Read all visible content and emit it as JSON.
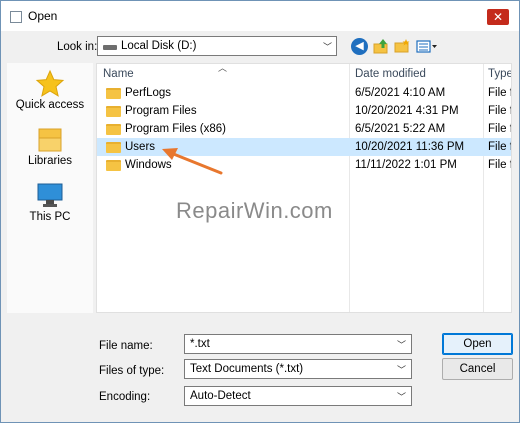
{
  "window": {
    "title": "Open",
    "close_glyph": "✕"
  },
  "toolbar": {
    "look_in_label": "Look in:",
    "look_in_value": "Local Disk (D:)",
    "buttons": [
      "back-icon",
      "up-folder-icon",
      "new-folder-icon",
      "view-menu-icon"
    ]
  },
  "places": [
    {
      "label": "Quick access",
      "icon": "star-icon"
    },
    {
      "label": "Libraries",
      "icon": "libraries-icon"
    },
    {
      "label": "This PC",
      "icon": "computer-icon"
    }
  ],
  "file_list": {
    "columns": [
      "Name",
      "Date modified",
      "Type"
    ],
    "rows": [
      {
        "name": "PerfLogs",
        "date": "6/5/2021 4:10 AM",
        "type": "File fo",
        "selected": false
      },
      {
        "name": "Program Files",
        "date": "10/20/2021 4:31 PM",
        "type": "File fo",
        "selected": false
      },
      {
        "name": "Program Files (x86)",
        "date": "6/5/2021 5:22 AM",
        "type": "File fo",
        "selected": false
      },
      {
        "name": "Users",
        "date": "10/20/2021 11:36 PM",
        "type": "File fo",
        "selected": true
      },
      {
        "name": "Windows",
        "date": "11/11/2022 1:01 PM",
        "type": "File fo",
        "selected": false
      }
    ]
  },
  "watermark": "RepairWin.com",
  "form": {
    "file_name_label": "File name:",
    "file_name_value": "*.txt",
    "files_of_type_label": "Files of type:",
    "files_of_type_value": "Text Documents (*.txt)",
    "encoding_label": "Encoding:",
    "encoding_value": "Auto-Detect"
  },
  "buttons": {
    "open": "Open",
    "cancel": "Cancel"
  },
  "colors": {
    "selection": "#cce8ff",
    "annotation_arrow": "#e8772e",
    "folder": "#f5c343",
    "close": "#c42b1c"
  }
}
